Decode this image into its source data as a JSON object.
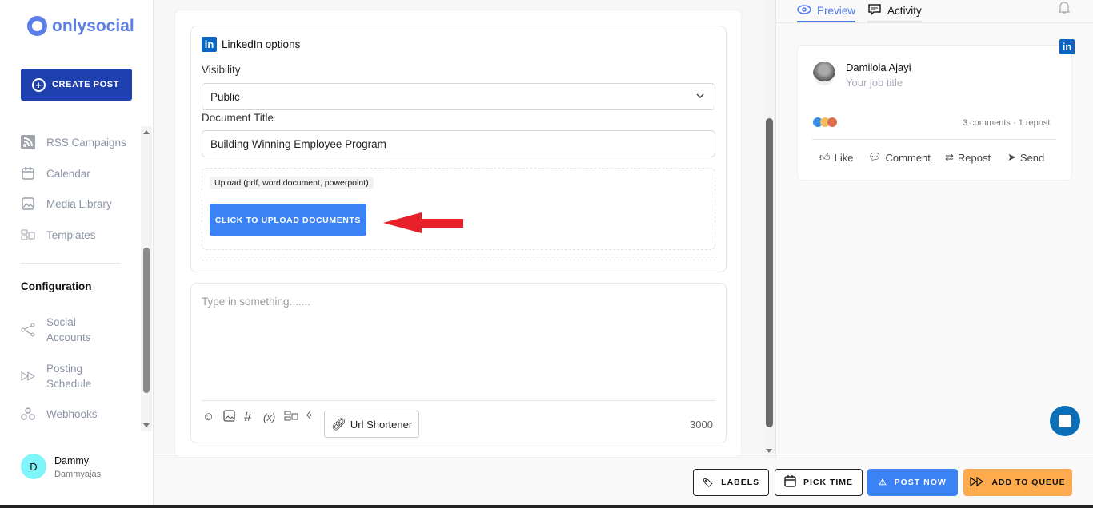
{
  "brand": {
    "name": "onlysocial",
    "color": "#5b7ee8"
  },
  "sidebar": {
    "create_post": "CREATE POST",
    "items": [
      {
        "label": "RSS Campaigns",
        "icon": "rss-icon"
      },
      {
        "label": "Calendar",
        "icon": "calendar-icon"
      },
      {
        "label": "Media Library",
        "icon": "image-icon"
      },
      {
        "label": "Templates",
        "icon": "templates-icon"
      }
    ],
    "section": "Configuration",
    "config_items": [
      {
        "label": "Social\nAccounts",
        "icon": "share-icon"
      },
      {
        "label": "Posting\nSchedule",
        "icon": "fast-forward-icon"
      },
      {
        "label": "Webhooks",
        "icon": "webhook-icon"
      }
    ],
    "user": {
      "initial": "D",
      "name": "Dammy",
      "handle": "Dammyajas"
    }
  },
  "linkedin": {
    "title": "LinkedIn options",
    "visibility_label": "Visibility",
    "visibility_value": "Public",
    "doc_title_label": "Document Title",
    "doc_title_value": "Building Winning Employee Program",
    "upload_hint": "Upload (pdf, word document, powerpoint)",
    "upload_button": "CLICK TO UPLOAD DOCUMENTS"
  },
  "editor": {
    "placeholder": "Type in something.......",
    "url_shortener": "Url Shortener",
    "char_count": "3000"
  },
  "preview": {
    "tabs": [
      "Preview",
      "Activity"
    ],
    "name": "Damilola Ajayi",
    "job_title": "Your job title",
    "stats": "3 comments · 1 repost",
    "actions": [
      "Like",
      "Comment",
      "Repost",
      "Send"
    ]
  },
  "footer": {
    "labels": "LABELS",
    "pick_time": "PICK TIME",
    "post_now": "POST NOW",
    "add_to_queue": "ADD TO QUEUE",
    "post_now_color": "#3b82f6",
    "queue_color": "#fdab4c"
  },
  "annotation_arrow_color": "#e8202a"
}
